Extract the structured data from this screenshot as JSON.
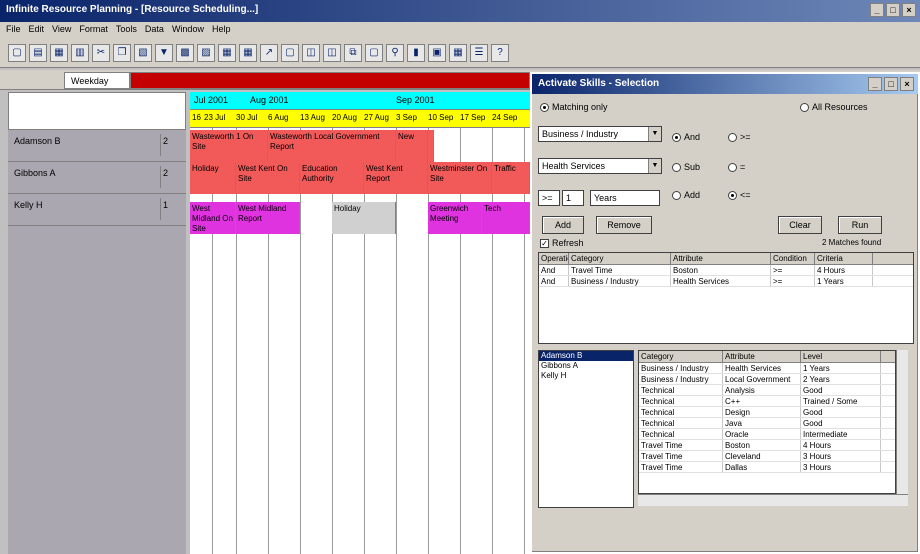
{
  "window": {
    "title": "Infinite Resource Planning - [Resource Scheduling...]"
  },
  "menu": [
    "File",
    "Edit",
    "View",
    "Format",
    "Tools",
    "Data",
    "Window",
    "Help"
  ],
  "tabs": {
    "active": "Weekday",
    "red": ""
  },
  "resources": [
    {
      "name": "Adamson B",
      "count": "2"
    },
    {
      "name": "Gibbons A",
      "count": "2"
    },
    {
      "name": "Kelly H",
      "count": "1"
    }
  ],
  "timeline": {
    "months": [
      "Jul 2001",
      "Aug 2001",
      "Sep 2001"
    ],
    "weeks": [
      "16",
      "23 Jul",
      "30 Jul",
      "6 Aug",
      "13 Aug",
      "20 Aug",
      "27 Aug",
      "3 Sep",
      "10 Sep",
      "17 Sep",
      "24 Sep"
    ]
  },
  "bookings": {
    "row1": [
      "Wasteworth 1 On Site",
      "Wasteworth Local Government Report",
      "New",
      ""
    ],
    "row2": [
      "Holiday",
      "West Kent On Site",
      "Education Authority",
      "West Kent Report",
      "Westminster On Site",
      "Traffic"
    ],
    "row3": [
      "West Midland On Site",
      "West Midland Report",
      "Holiday",
      "Greenwich Meeting",
      "Tech"
    ]
  },
  "dialog": {
    "title": "Activate Skills - Selection",
    "match_only": "Matching only",
    "all_resources": "All Resources",
    "category_value": "Business / Industry",
    "attribute_value": "Health Services",
    "op_and": "And",
    "op_sub": "Sub",
    "op_add": "Add",
    "cmp1": ">=",
    "cmp2": "=",
    "cmp3": "<=",
    "qty_op": ">=",
    "qty_num": "1",
    "qty_unit": "Years",
    "add_btn": "Add",
    "remove_btn": "Remove",
    "clear_btn": "Clear",
    "run_btn": "Run",
    "refresh_label": "Refresh",
    "matches": "2 Matches found",
    "criteria_headers": [
      "Operation",
      "Category",
      "Attribute",
      "Condition",
      "Criteria"
    ],
    "criteria_rows": [
      [
        "And",
        "Travel Time",
        "Boston",
        ">=",
        "4 Hours"
      ],
      [
        "And",
        "Business / Industry",
        "Health Services",
        ">=",
        "1 Years"
      ]
    ],
    "results": [
      "Adamson B",
      "Gibbons A",
      "Kelly H"
    ],
    "skill_headers": [
      "Category",
      "Attribute",
      "Level"
    ],
    "skill_rows": [
      [
        "Business / Industry",
        "Health Services",
        "1 Years"
      ],
      [
        "Business / Industry",
        "Local Government",
        "2 Years"
      ],
      [
        "Technical",
        "Analysis",
        "Good"
      ],
      [
        "Technical",
        "C++",
        "Trained / Some"
      ],
      [
        "Technical",
        "Design",
        "Good"
      ],
      [
        "Technical",
        "Java",
        "Good"
      ],
      [
        "Technical",
        "Oracle",
        "Intermediate"
      ],
      [
        "Travel Time",
        "Boston",
        "4 Hours"
      ],
      [
        "Travel Time",
        "Cleveland",
        "3 Hours"
      ],
      [
        "Travel Time",
        "Dallas",
        "3 Hours"
      ]
    ]
  }
}
